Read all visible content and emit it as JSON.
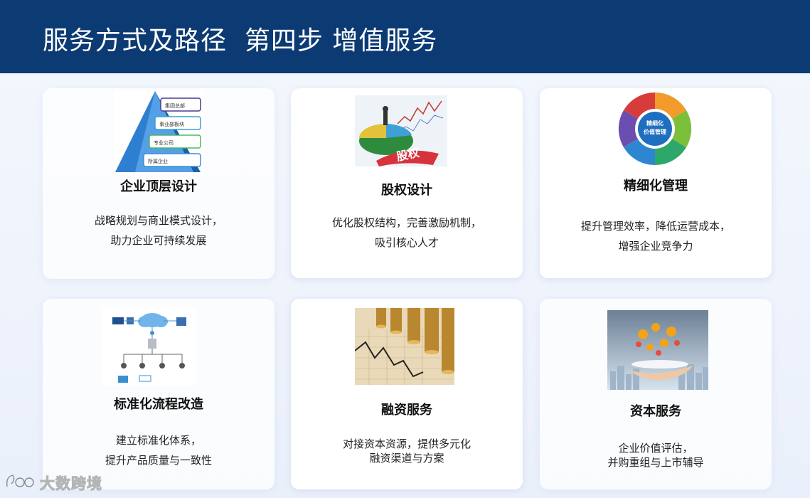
{
  "header": {
    "title": "服务方式及路径  第四步 增值服务"
  },
  "cards": [
    {
      "title": "企业顶层设计",
      "desc": [
        "战略规划与商业模式设计，",
        "助力企业可持续发展"
      ],
      "image": {
        "labels": [
          "集团总部",
          "事业部板块",
          "专业公司",
          "所属企业"
        ]
      }
    },
    {
      "title": "股权设计",
      "desc": [
        "优化股权结构，完善激励机制，",
        "吸引核心人才"
      ],
      "image": {
        "labels": [
          "股权"
        ]
      }
    },
    {
      "title": "精细化管理",
      "desc": [
        "提升管理效率，降低运营成本，",
        "增强企业竞争力"
      ],
      "image": {
        "labels": [
          "精细化",
          "价值管理"
        ]
      }
    },
    {
      "title": "标准化流程改造",
      "desc": [
        "建立标准化体系，",
        "提升产品质量与一致性"
      ],
      "image": {
        "labels": []
      }
    },
    {
      "title": "融资服务",
      "desc": [
        "对接资本资源，提供多元化",
        "融资渠道与方案"
      ],
      "image": {
        "labels": []
      }
    },
    {
      "title": "资本服务",
      "desc": [
        "企业价值评估，",
        "并购重组与上市辅导"
      ],
      "image": {
        "labels": []
      }
    }
  ],
  "watermark": {
    "text": "大数跨境",
    "logo": "logo-mark-icon"
  },
  "colors": {
    "header_bg": "#0c3a73",
    "title_text": "#ffffff",
    "card_bg": "#ffffff"
  }
}
